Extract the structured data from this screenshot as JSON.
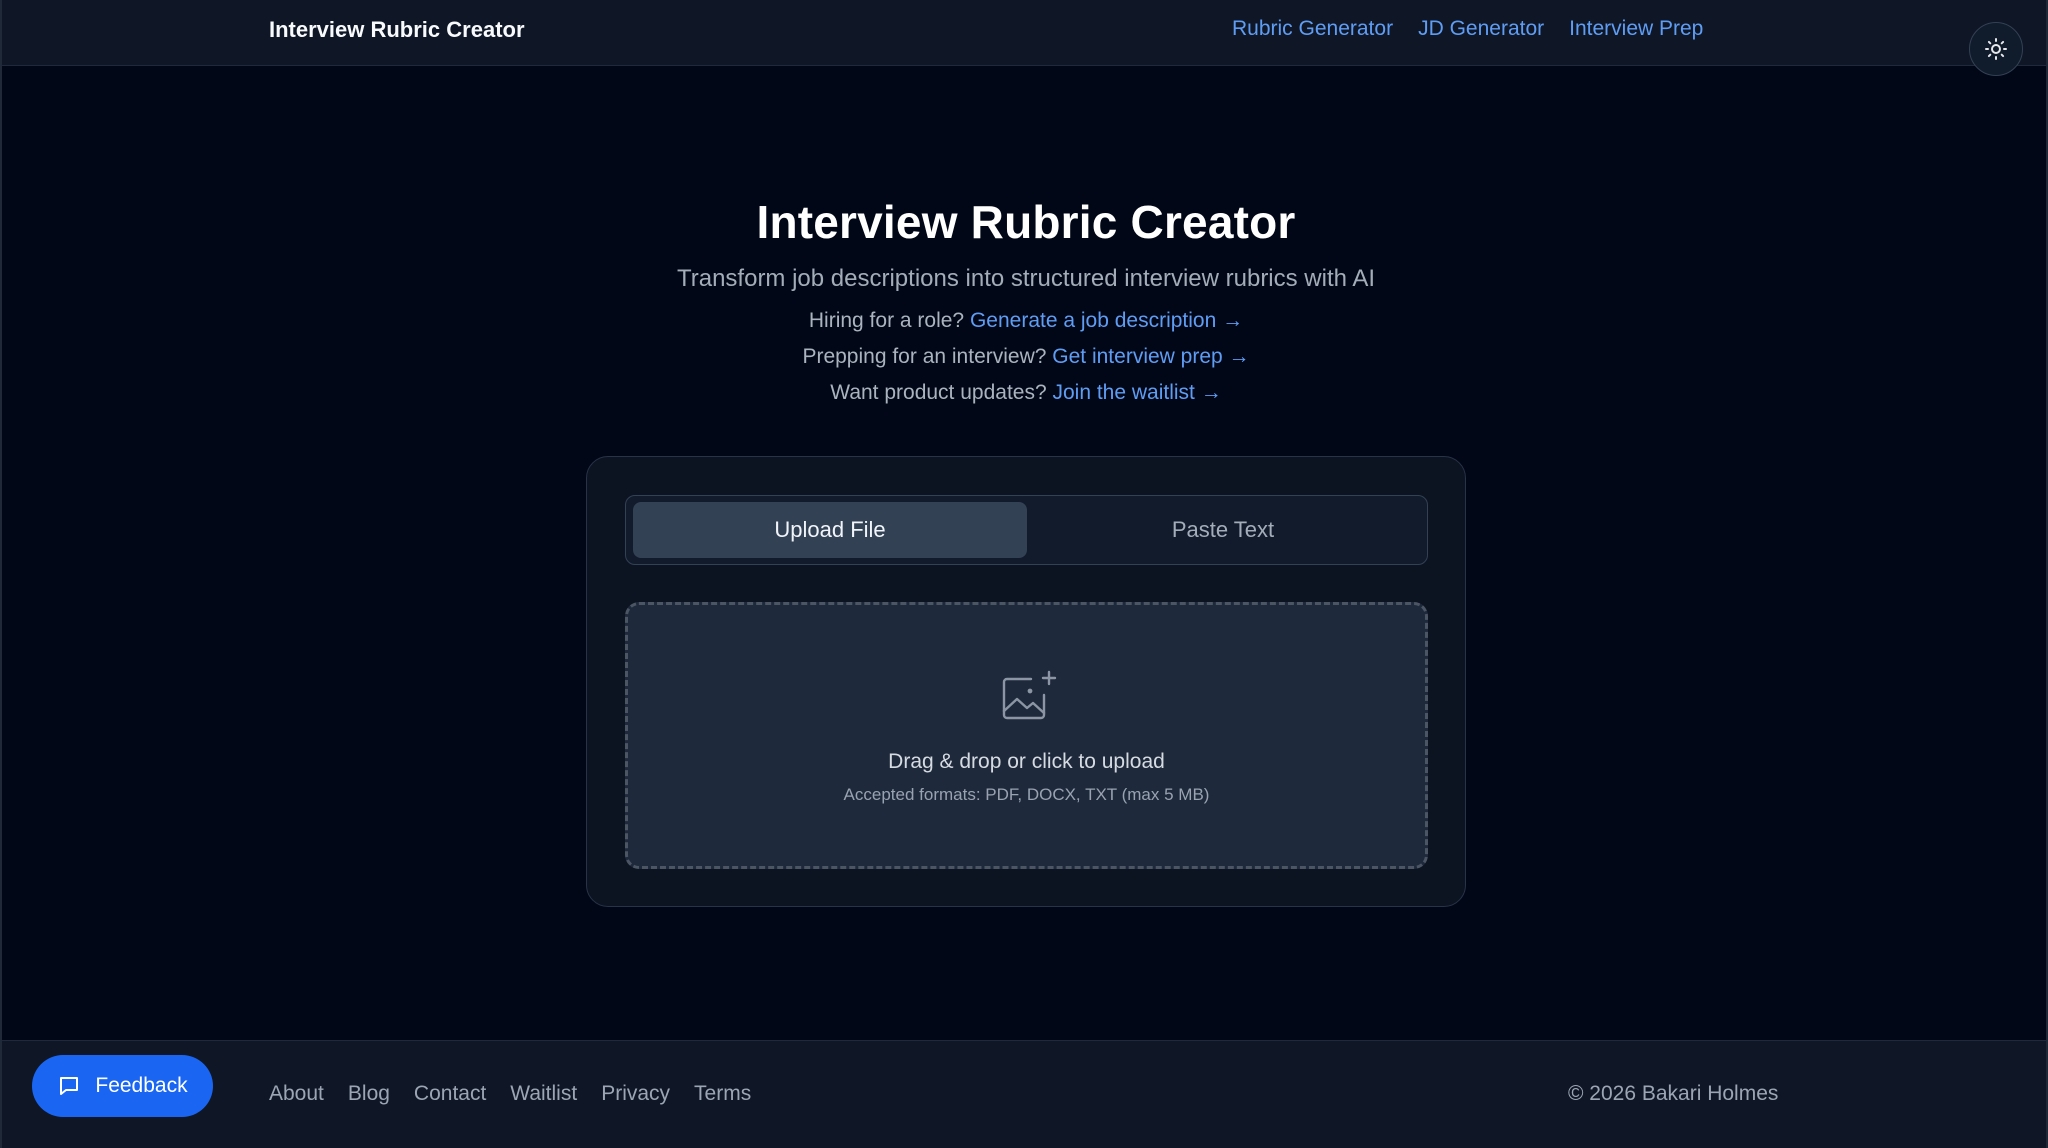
{
  "header": {
    "brand": "Interview Rubric Creator",
    "nav": [
      {
        "label": "Rubric Generator"
      },
      {
        "label": "JD Generator"
      },
      {
        "label": "Interview Prep"
      }
    ],
    "theme_toggle_icon": "sun-icon"
  },
  "hero": {
    "title": "Interview Rubric Creator",
    "subtitle": "Transform job descriptions into structured interview rubrics with AI",
    "promos": [
      {
        "prefix": "Hiring for a role?",
        "link": "Generate a job description →"
      },
      {
        "prefix": "Prepping for an interview?",
        "link": "Get interview prep →"
      },
      {
        "prefix": "Want product updates?",
        "link": "Join the waitlist →"
      }
    ]
  },
  "upload": {
    "tabs": [
      {
        "label": "Upload File",
        "active": true
      },
      {
        "label": "Paste Text",
        "active": false
      }
    ],
    "icon": "image-add-icon",
    "title": "Drag & drop or click to upload",
    "formats": "Accepted formats: PDF, DOCX, TXT (max 5 MB)"
  },
  "footer": {
    "feedback_label": "Feedback",
    "feedback_icon": "chat-bubble-icon",
    "links": [
      {
        "label": "About"
      },
      {
        "label": "Blog"
      },
      {
        "label": "Contact"
      },
      {
        "label": "Waitlist"
      },
      {
        "label": "Privacy"
      },
      {
        "label": "Terms"
      }
    ],
    "copyright": "© 2026 Bakari Holmes"
  },
  "colors": {
    "background": "#010716",
    "surface": "#0f1726",
    "link": "#5f9df5",
    "primary_button": "#1a66f2"
  }
}
